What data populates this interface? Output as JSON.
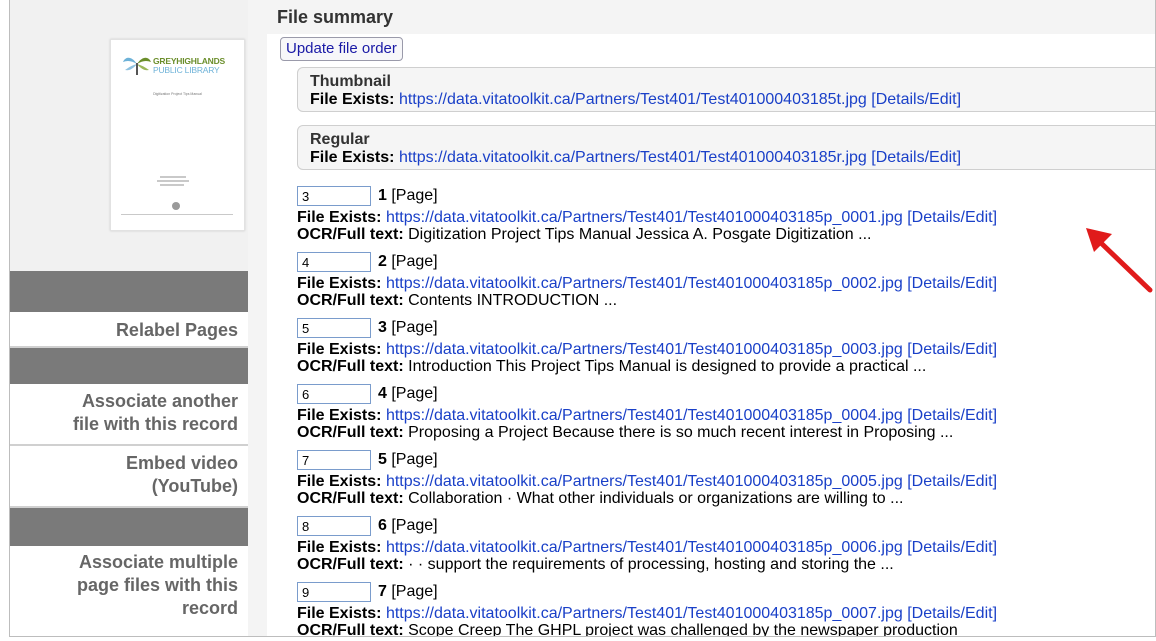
{
  "summary_title": "File summary",
  "update_button": "Update file order",
  "thumbnail_logo": {
    "line1": "GREYHIGHLANDS",
    "line2": "PUBLIC LIBRARY",
    "subtitle": "Digitization Project Tips Manual"
  },
  "sidebar": {
    "relabel": "Relabel Pages",
    "associate_another": [
      "Associate another",
      "file with this record"
    ],
    "embed_video": [
      "Embed video",
      "(YouTube)"
    ],
    "associate_multiple": [
      "Associate multiple",
      "page files with this",
      "record"
    ]
  },
  "file_exists_label": "File Exists:",
  "ocr_label": "OCR/Full text:",
  "details_label": "[Details/Edit]",
  "page_type": "[Page]",
  "thumbnail": {
    "heading": "Thumbnail",
    "url": "https://data.vitatoolkit.ca/Partners/Test401/Test401000403185t.jpg"
  },
  "regular": {
    "heading": "Regular",
    "url": "https://data.vitatoolkit.ca/Partners/Test401/Test401000403185r.jpg"
  },
  "pages": [
    {
      "order": "3",
      "num": "1",
      "url": "https://data.vitatoolkit.ca/Partners/Test401/Test401000403185p_0001.jpg",
      "ocr": "Digitization Project Tips Manual Jessica A. Posgate Digitization ..."
    },
    {
      "order": "4",
      "num": "2",
      "url": "https://data.vitatoolkit.ca/Partners/Test401/Test401000403185p_0002.jpg",
      "ocr": "Contents INTRODUCTION ..."
    },
    {
      "order": "5",
      "num": "3",
      "url": "https://data.vitatoolkit.ca/Partners/Test401/Test401000403185p_0003.jpg",
      "ocr": "Introduction This Project Tips Manual is designed to provide a practical ..."
    },
    {
      "order": "6",
      "num": "4",
      "url": "https://data.vitatoolkit.ca/Partners/Test401/Test401000403185p_0004.jpg",
      "ocr": "Proposing a Project Because there is so much recent interest in Proposing ..."
    },
    {
      "order": "7",
      "num": "5",
      "url": "https://data.vitatoolkit.ca/Partners/Test401/Test401000403185p_0005.jpg",
      "ocr": "Collaboration · What other individuals or organizations are willing to ..."
    },
    {
      "order": "8",
      "num": "6",
      "url": "https://data.vitatoolkit.ca/Partners/Test401/Test401000403185p_0006.jpg",
      "ocr": "· · support the requirements of processing, hosting and storing the ..."
    },
    {
      "order": "9",
      "num": "7",
      "url": "https://data.vitatoolkit.ca/Partners/Test401/Test401000403185p_0007.jpg",
      "ocr": "Scope Creep The GHPL project was challenged by the newspaper production"
    }
  ],
  "colors": {
    "link": "#1a40c8",
    "arrow": "#e01b1b",
    "sidebar_dark": "#7a7a7a"
  }
}
